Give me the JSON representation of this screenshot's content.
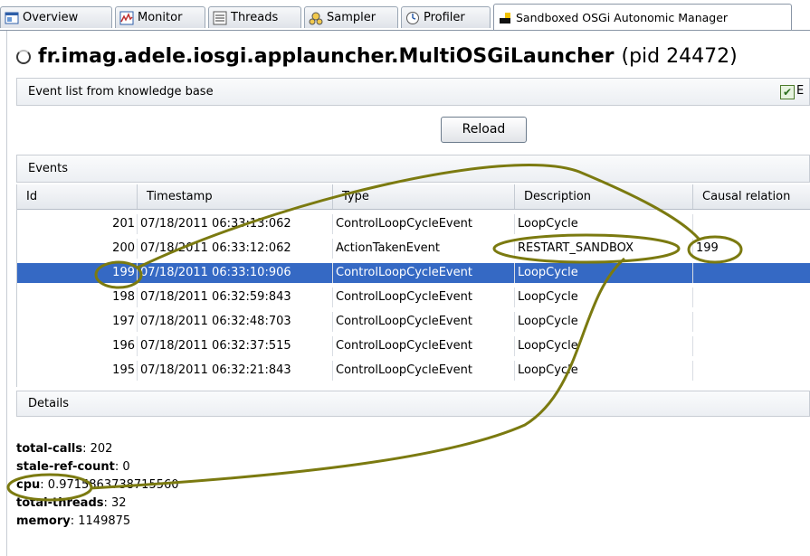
{
  "tabs": [
    {
      "label": "Overview",
      "icon": "overview-icon",
      "active": false
    },
    {
      "label": "Monitor",
      "icon": "monitor-icon",
      "active": false
    },
    {
      "label": "Threads",
      "icon": "threads-icon",
      "active": false
    },
    {
      "label": "Sampler",
      "icon": "sampler-icon",
      "active": false
    },
    {
      "label": "Profiler",
      "icon": "profiler-icon",
      "active": false
    },
    {
      "label": "Sandboxed OSGi Autonomic Manager",
      "icon": "sandbox-icon",
      "active": true
    }
  ],
  "header": {
    "app_name": "fr.imag.adele.iosgi.applauncher.MultiOSGiLauncher",
    "pid": "(pid 24472)"
  },
  "event_list": {
    "title": "Event list from knowledge base",
    "checkbox_label": "E",
    "checked": true
  },
  "reload_label": "Reload",
  "events": {
    "title": "Events",
    "columns": [
      "Id",
      "Timestamp",
      "Type",
      "Description",
      "Causal relation"
    ],
    "rows": [
      {
        "id": "201",
        "timestamp": "07/18/2011 06:33:13:062",
        "type": "ControlLoopCycleEvent",
        "description": "LoopCycle",
        "causal": ""
      },
      {
        "id": "200",
        "timestamp": "07/18/2011 06:33:12:062",
        "type": "ActionTakenEvent",
        "description": "RESTART_SANDBOX",
        "causal": "199"
      },
      {
        "id": "199",
        "timestamp": "07/18/2011 06:33:10:906",
        "type": "ControlLoopCycleEvent",
        "description": "LoopCycle",
        "causal": "",
        "selected": true
      },
      {
        "id": "198",
        "timestamp": "07/18/2011 06:32:59:843",
        "type": "ControlLoopCycleEvent",
        "description": "LoopCycle",
        "causal": ""
      },
      {
        "id": "197",
        "timestamp": "07/18/2011 06:32:48:703",
        "type": "ControlLoopCycleEvent",
        "description": "LoopCycle",
        "causal": ""
      },
      {
        "id": "196",
        "timestamp": "07/18/2011 06:32:37:515",
        "type": "ControlLoopCycleEvent",
        "description": "LoopCycle",
        "causal": ""
      },
      {
        "id": "195",
        "timestamp": "07/18/2011 06:32:21:843",
        "type": "ControlLoopCycleEvent",
        "description": "LoopCycle",
        "causal": ""
      }
    ]
  },
  "details": {
    "title": "Details",
    "items": [
      {
        "key": "total-calls",
        "value": "202"
      },
      {
        "key": "stale-ref-count",
        "value": "0"
      },
      {
        "key": "cpu",
        "value": "0.9715863738715560"
      },
      {
        "key": "total-threads",
        "value": "32"
      },
      {
        "key": "memory",
        "value": "1149875"
      }
    ]
  },
  "colors": {
    "selection": "#3569c4",
    "annotation": "#7b7a10"
  }
}
